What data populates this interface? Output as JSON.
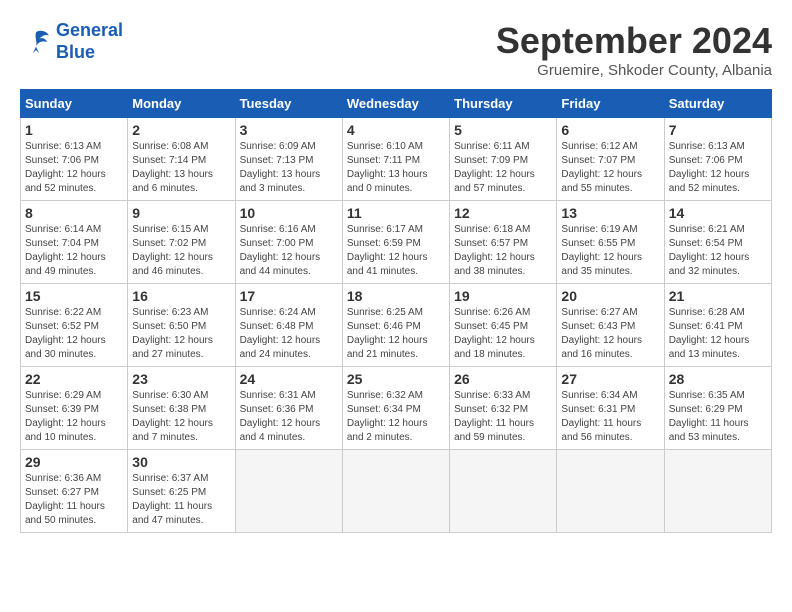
{
  "logo": {
    "line1": "General",
    "line2": "Blue"
  },
  "title": "September 2024",
  "subtitle": "Gruemire, Shkoder County, Albania",
  "weekdays": [
    "Sunday",
    "Monday",
    "Tuesday",
    "Wednesday",
    "Thursday",
    "Friday",
    "Saturday"
  ],
  "days": [
    {
      "date": "",
      "empty": true
    },
    {
      "date": "",
      "empty": true
    },
    {
      "date": "",
      "empty": true
    },
    {
      "date": "",
      "empty": true
    },
    {
      "date": "",
      "empty": true
    },
    {
      "date": "",
      "empty": true
    },
    {
      "num": "1",
      "sunrise": "Sunrise: 6:13 AM",
      "sunset": "Sunset: 7:06 PM",
      "daylight": "Daylight: 12 hours and 52 minutes."
    },
    {
      "num": "2",
      "sunrise": "Sunrise: 6:08 AM",
      "sunset": "Sunset: 7:14 PM",
      "daylight": "Daylight: 13 hours and 6 minutes."
    },
    {
      "num": "3",
      "sunrise": "Sunrise: 6:09 AM",
      "sunset": "Sunset: 7:13 PM",
      "daylight": "Daylight: 13 hours and 3 minutes."
    },
    {
      "num": "4",
      "sunrise": "Sunrise: 6:10 AM",
      "sunset": "Sunset: 7:11 PM",
      "daylight": "Daylight: 13 hours and 0 minutes."
    },
    {
      "num": "5",
      "sunrise": "Sunrise: 6:11 AM",
      "sunset": "Sunset: 7:09 PM",
      "daylight": "Daylight: 12 hours and 57 minutes."
    },
    {
      "num": "6",
      "sunrise": "Sunrise: 6:12 AM",
      "sunset": "Sunset: 7:07 PM",
      "daylight": "Daylight: 12 hours and 55 minutes."
    },
    {
      "num": "7",
      "sunrise": "Sunrise: 6:13 AM",
      "sunset": "Sunset: 7:06 PM",
      "daylight": "Daylight: 12 hours and 52 minutes."
    },
    {
      "num": "8",
      "sunrise": "Sunrise: 6:14 AM",
      "sunset": "Sunset: 7:04 PM",
      "daylight": "Daylight: 12 hours and 49 minutes."
    },
    {
      "num": "9",
      "sunrise": "Sunrise: 6:15 AM",
      "sunset": "Sunset: 7:02 PM",
      "daylight": "Daylight: 12 hours and 46 minutes."
    },
    {
      "num": "10",
      "sunrise": "Sunrise: 6:16 AM",
      "sunset": "Sunset: 7:00 PM",
      "daylight": "Daylight: 12 hours and 44 minutes."
    },
    {
      "num": "11",
      "sunrise": "Sunrise: 6:17 AM",
      "sunset": "Sunset: 6:59 PM",
      "daylight": "Daylight: 12 hours and 41 minutes."
    },
    {
      "num": "12",
      "sunrise": "Sunrise: 6:18 AM",
      "sunset": "Sunset: 6:57 PM",
      "daylight": "Daylight: 12 hours and 38 minutes."
    },
    {
      "num": "13",
      "sunrise": "Sunrise: 6:19 AM",
      "sunset": "Sunset: 6:55 PM",
      "daylight": "Daylight: 12 hours and 35 minutes."
    },
    {
      "num": "14",
      "sunrise": "Sunrise: 6:21 AM",
      "sunset": "Sunset: 6:54 PM",
      "daylight": "Daylight: 12 hours and 32 minutes."
    },
    {
      "num": "15",
      "sunrise": "Sunrise: 6:22 AM",
      "sunset": "Sunset: 6:52 PM",
      "daylight": "Daylight: 12 hours and 30 minutes."
    },
    {
      "num": "16",
      "sunrise": "Sunrise: 6:23 AM",
      "sunset": "Sunset: 6:50 PM",
      "daylight": "Daylight: 12 hours and 27 minutes."
    },
    {
      "num": "17",
      "sunrise": "Sunrise: 6:24 AM",
      "sunset": "Sunset: 6:48 PM",
      "daylight": "Daylight: 12 hours and 24 minutes."
    },
    {
      "num": "18",
      "sunrise": "Sunrise: 6:25 AM",
      "sunset": "Sunset: 6:46 PM",
      "daylight": "Daylight: 12 hours and 21 minutes."
    },
    {
      "num": "19",
      "sunrise": "Sunrise: 6:26 AM",
      "sunset": "Sunset: 6:45 PM",
      "daylight": "Daylight: 12 hours and 18 minutes."
    },
    {
      "num": "20",
      "sunrise": "Sunrise: 6:27 AM",
      "sunset": "Sunset: 6:43 PM",
      "daylight": "Daylight: 12 hours and 16 minutes."
    },
    {
      "num": "21",
      "sunrise": "Sunrise: 6:28 AM",
      "sunset": "Sunset: 6:41 PM",
      "daylight": "Daylight: 12 hours and 13 minutes."
    },
    {
      "num": "22",
      "sunrise": "Sunrise: 6:29 AM",
      "sunset": "Sunset: 6:39 PM",
      "daylight": "Daylight: 12 hours and 10 minutes."
    },
    {
      "num": "23",
      "sunrise": "Sunrise: 6:30 AM",
      "sunset": "Sunset: 6:38 PM",
      "daylight": "Daylight: 12 hours and 7 minutes."
    },
    {
      "num": "24",
      "sunrise": "Sunrise: 6:31 AM",
      "sunset": "Sunset: 6:36 PM",
      "daylight": "Daylight: 12 hours and 4 minutes."
    },
    {
      "num": "25",
      "sunrise": "Sunrise: 6:32 AM",
      "sunset": "Sunset: 6:34 PM",
      "daylight": "Daylight: 12 hours and 2 minutes."
    },
    {
      "num": "26",
      "sunrise": "Sunrise: 6:33 AM",
      "sunset": "Sunset: 6:32 PM",
      "daylight": "Daylight: 11 hours and 59 minutes."
    },
    {
      "num": "27",
      "sunrise": "Sunrise: 6:34 AM",
      "sunset": "Sunset: 6:31 PM",
      "daylight": "Daylight: 11 hours and 56 minutes."
    },
    {
      "num": "28",
      "sunrise": "Sunrise: 6:35 AM",
      "sunset": "Sunset: 6:29 PM",
      "daylight": "Daylight: 11 hours and 53 minutes."
    },
    {
      "num": "29",
      "sunrise": "Sunrise: 6:36 AM",
      "sunset": "Sunset: 6:27 PM",
      "daylight": "Daylight: 11 hours and 50 minutes."
    },
    {
      "num": "30",
      "sunrise": "Sunrise: 6:37 AM",
      "sunset": "Sunset: 6:25 PM",
      "daylight": "Daylight: 11 hours and 47 minutes."
    },
    {
      "date": "",
      "empty": true
    },
    {
      "date": "",
      "empty": true
    },
    {
      "date": "",
      "empty": true
    },
    {
      "date": "",
      "empty": true
    },
    {
      "date": "",
      "empty": true
    }
  ]
}
